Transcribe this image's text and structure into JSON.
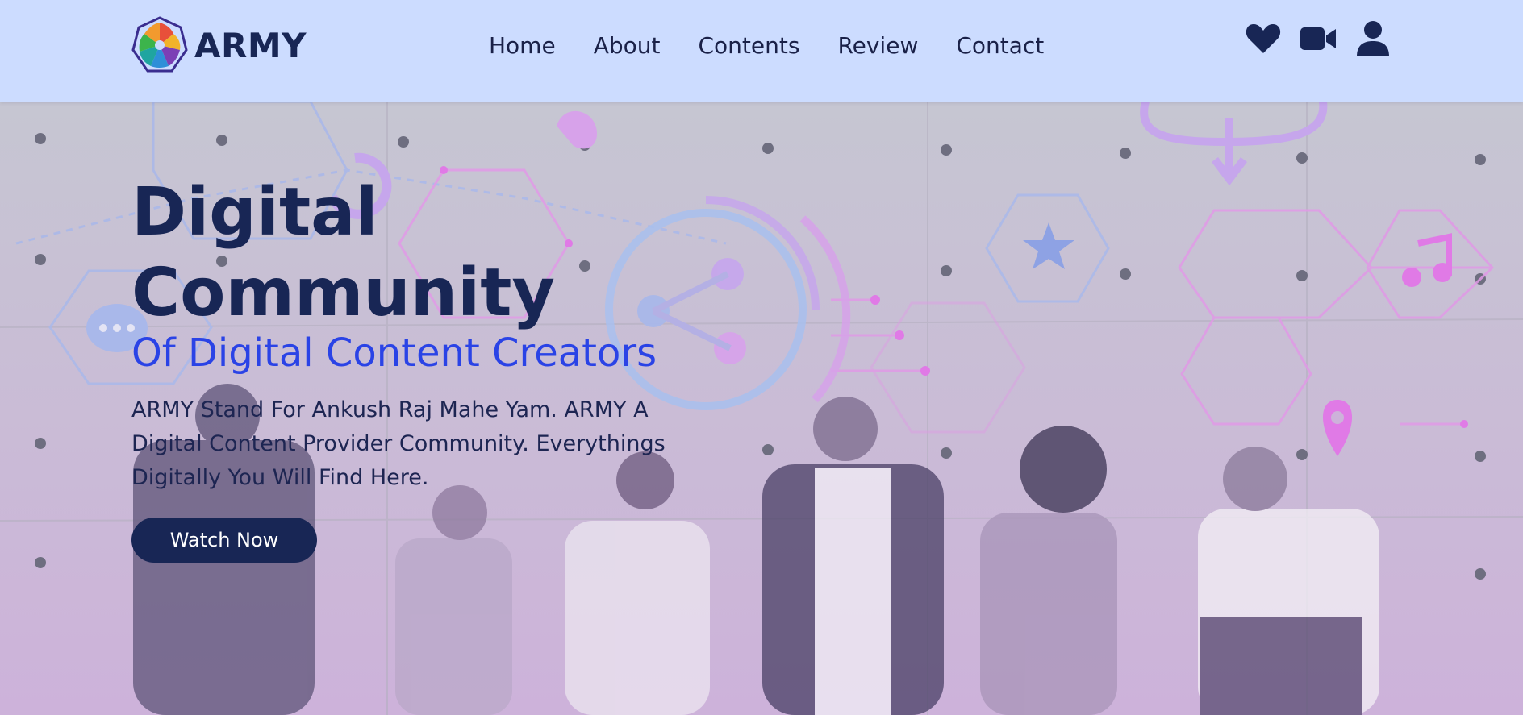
{
  "brand": {
    "name": "ARMY"
  },
  "nav": {
    "items": [
      {
        "label": "Home"
      },
      {
        "label": "About"
      },
      {
        "label": "Contents"
      },
      {
        "label": "Review"
      },
      {
        "label": "Contact"
      }
    ]
  },
  "actions": [
    {
      "icon": "heart-icon"
    },
    {
      "icon": "video-camera-icon"
    },
    {
      "icon": "user-icon"
    }
  ],
  "hero": {
    "title_line1": "Digital",
    "title_line2": "Community",
    "subtitle": "Of Digital Content Creators",
    "description": "ARMY Stand For Ankush Raj Mahe Yam. ARMY A Digital Content Provider Community. Everythings Digitally You Will Find Here.",
    "cta_label": "Watch Now"
  },
  "colors": {
    "header_bg": "#ccdcff",
    "navy": "#182655",
    "accent_blue": "#2a43e6"
  }
}
